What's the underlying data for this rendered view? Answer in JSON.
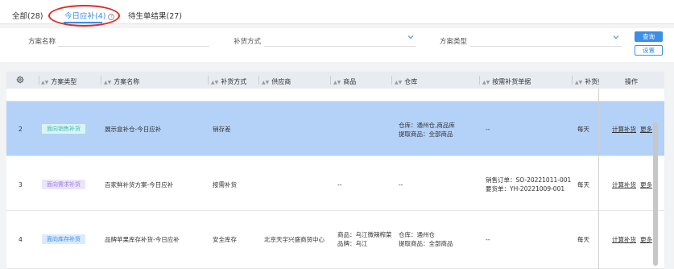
{
  "tabs": [
    {
      "label": "全部(28)"
    },
    {
      "label": "今日应补(4)"
    },
    {
      "label": "待生单结果(27)"
    }
  ],
  "filters": {
    "scheme_name_label": "方案名称",
    "replenish_method_label": "补货方式",
    "scheme_type_label": "方案类型",
    "query_button": "查询",
    "settings_button": "设置"
  },
  "table": {
    "headers": [
      "方案类型",
      "方案名称",
      "补货方式",
      "供应商",
      "商品",
      "仓库",
      "按需补货单据",
      "补货频",
      "操作"
    ],
    "rows": [
      {
        "index": "2",
        "type": "面向销售补货",
        "name": "展示盒补仓-今日应补",
        "method": "销存差",
        "supplier": "",
        "product_lines": [
          "",
          ""
        ],
        "warehouse_lines": [
          "仓库：通州仓,商品库",
          "提取商品：全部商品"
        ],
        "docs_lines": [
          "--",
          ""
        ],
        "freq": "每天",
        "action_calc": "计算补货",
        "action_more": "更多"
      },
      {
        "index": "3",
        "type": "面向需求补货",
        "name": "百家鲜补货方案-今日应补",
        "method": "按需补货",
        "supplier": "",
        "product_lines": [
          "--",
          ""
        ],
        "warehouse_lines": [
          "--",
          ""
        ],
        "docs_lines": [
          "销售订单：SO-20221011-001",
          "要货单：YH-20221009-001"
        ],
        "freq": "每天",
        "action_calc": "计算补货",
        "action_more": "更多"
      },
      {
        "index": "4",
        "type": "面向库存补货",
        "name": "品牌苹果库存补货-今日应补",
        "method": "安全库存",
        "supplier": "北京天宇兴盛商贸中心",
        "product_lines": [
          "商品：乌江微辣榨菜",
          "品牌：乌江"
        ],
        "warehouse_lines": [
          "仓库：通州仓",
          "提取商品：全部商品"
        ],
        "docs_lines": [
          "--",
          ""
        ],
        "freq": "每天",
        "action_calc": "计算补货",
        "action_more": "更多"
      }
    ]
  },
  "colors": {
    "primary": "#3a8ee6",
    "selected_row": "#b4d1f7",
    "annotation_red": "#e4281f",
    "tag_sales_bg": "#d9f4f4",
    "tag_sales_fg": "#3fb8b8",
    "tag_demand_bg": "#ece4fb",
    "tag_demand_fg": "#9a7be0",
    "tag_stock_bg": "#dbeafd",
    "tag_stock_fg": "#3a8ee6"
  }
}
